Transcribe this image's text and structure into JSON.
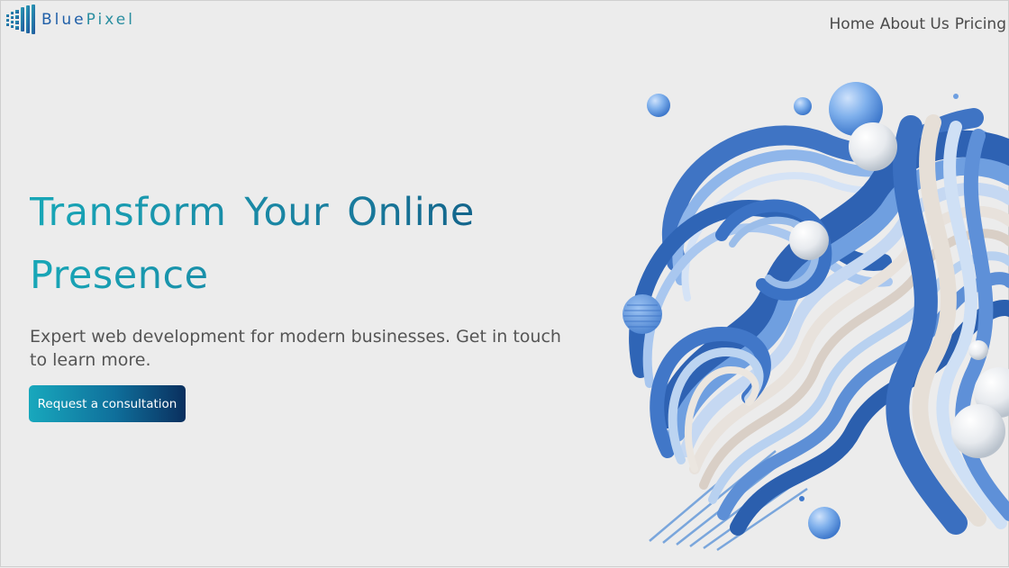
{
  "brand": {
    "name_part1": "Blue",
    "name_part2": "Pixel",
    "colors": {
      "blue": "#1f5fa8",
      "teal": "#2a8ea0"
    }
  },
  "nav": {
    "items": [
      {
        "label": "Home"
      },
      {
        "label": "About Us"
      },
      {
        "label": "Pricing"
      }
    ]
  },
  "hero": {
    "title_words": [
      "Transform",
      "Your",
      "Online",
      "Presence"
    ],
    "subtitle": "Expert web development for modern businesses. Get in touch to learn more.",
    "cta_label": "Request a consultation",
    "gradient_colors": [
      "#18a7b7",
      "#1a7e9f",
      "#0d4f7a"
    ]
  },
  "illustration": {
    "icon": "abstract-blue-waves-illustration"
  }
}
